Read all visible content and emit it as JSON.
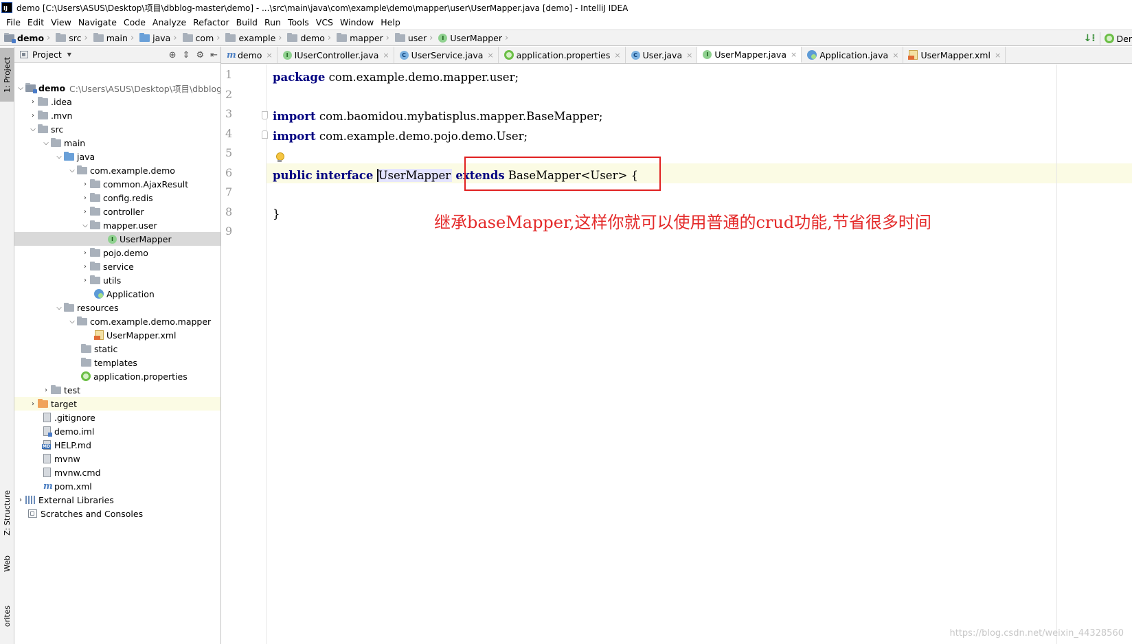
{
  "window": {
    "title": "demo [C:\\Users\\ASUS\\Desktop\\项目\\dbblog-master\\demo] - ...\\src\\main\\java\\com\\example\\demo\\mapper\\user\\UserMapper.java [demo] - IntelliJ IDEA",
    "logo": "IJ"
  },
  "menu": [
    "File",
    "Edit",
    "View",
    "Navigate",
    "Code",
    "Analyze",
    "Refactor",
    "Build",
    "Run",
    "Tools",
    "VCS",
    "Window",
    "Help"
  ],
  "breadcrumbs": [
    "demo",
    "src",
    "main",
    "java",
    "com",
    "example",
    "demo",
    "mapper",
    "user",
    "UserMapper"
  ],
  "nav_right": {
    "run_config": "Der"
  },
  "tool_stripe": {
    "project": "1: Project",
    "structure": "Z: Structure",
    "web": "Web",
    "favorites": "orites"
  },
  "project_panel": {
    "title": "Project",
    "tree": [
      {
        "label": "demo",
        "path": "C:\\Users\\ASUS\\Desktop\\项目\\dbblog-ma"
      },
      {
        "label": ".idea"
      },
      {
        "label": ".mvn"
      },
      {
        "label": "src"
      },
      {
        "label": "main"
      },
      {
        "label": "java"
      },
      {
        "label": "com.example.demo"
      },
      {
        "label": "common.AjaxResult"
      },
      {
        "label": "config.redis"
      },
      {
        "label": "controller"
      },
      {
        "label": "mapper.user"
      },
      {
        "label": "UserMapper",
        "icon_letter": "I"
      },
      {
        "label": "pojo.demo"
      },
      {
        "label": "service"
      },
      {
        "label": "utils"
      },
      {
        "label": "Application"
      },
      {
        "label": "resources"
      },
      {
        "label": "com.example.demo.mapper"
      },
      {
        "label": "UserMapper.xml"
      },
      {
        "label": "static"
      },
      {
        "label": "templates"
      },
      {
        "label": "application.properties"
      },
      {
        "label": "test"
      },
      {
        "label": "target"
      },
      {
        "label": ".gitignore"
      },
      {
        "label": "demo.iml"
      },
      {
        "label": "HELP.md"
      },
      {
        "label": "mvnw"
      },
      {
        "label": "mvnw.cmd"
      },
      {
        "label": "pom.xml",
        "icon_letter": "m"
      },
      {
        "label": "External Libraries"
      },
      {
        "label": "Scratches and Consoles"
      }
    ]
  },
  "tabs": [
    {
      "label": "demo",
      "icon_letter": "m"
    },
    {
      "label": "IUserController.java",
      "icon_letter": "I"
    },
    {
      "label": "UserService.java",
      "icon_letter": "C"
    },
    {
      "label": "application.properties"
    },
    {
      "label": "User.java",
      "icon_letter": "C"
    },
    {
      "label": "UserMapper.java",
      "icon_letter": "I"
    },
    {
      "label": "Application.java"
    },
    {
      "label": "UserMapper.xml"
    }
  ],
  "tab_close": "×",
  "editor": {
    "line_numbers": [
      "1",
      "2",
      "3",
      "4",
      "5",
      "6",
      "7",
      "8",
      "9"
    ],
    "line1": {
      "kw": "package",
      "rest": " com.example.demo.mapper.user;"
    },
    "line3": {
      "kw": "import",
      "rest": " com.baomidou.mybatisplus.mapper.BaseMapper;"
    },
    "line4": {
      "kw": "import",
      "rest": " com.example.demo.pojo.demo.User;"
    },
    "line6": {
      "kw1": "public",
      "kw2": "interface",
      "name": "UserMapper",
      "kw3": "extends",
      "rest": " BaseMapper<User> {"
    },
    "line8": {
      "text": "}"
    },
    "annotation": "继承baseMapper,这样你就可以使用普通的crud功能,节省很多时间",
    "watermark": "https://blog.csdn.net/weixin_44328560"
  }
}
